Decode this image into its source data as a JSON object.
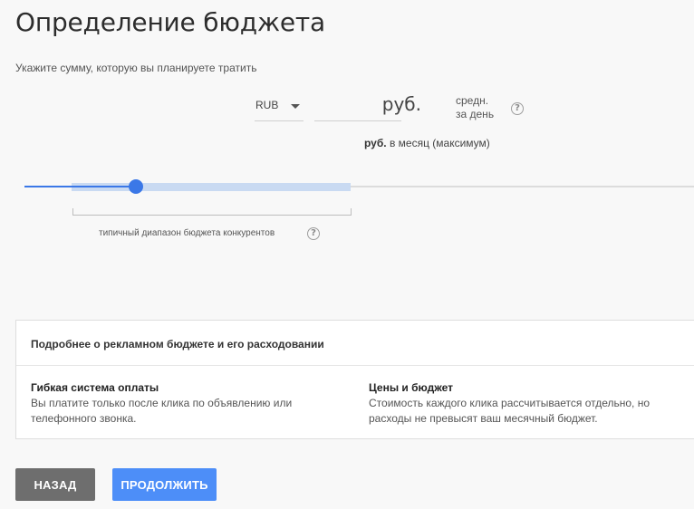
{
  "header": {
    "title": "Определение бюджета",
    "subtitle": "Укажите сумму, которую вы планируете тратить"
  },
  "budget": {
    "currency": "RUB",
    "amount_value": "",
    "amount_placeholder": "",
    "unit": "руб.",
    "per_day_line1": "средн.",
    "per_day_line2": "за день",
    "monthly_unit": "руб.",
    "monthly_text": "в месяц (максимум)"
  },
  "slider": {
    "value_fraction": 0.16,
    "competitor_range_label": "типичный диапазон бюджета конкурентов",
    "accent": "#3b78e7",
    "range_color": "#c9daf2"
  },
  "info_card": {
    "title": "Подробнее о рекламном бюджете и его расходовании",
    "columns": [
      {
        "heading": "Гибкая система оплаты",
        "text": "Вы платите только после клика по объявлению или телефонного звонка."
      },
      {
        "heading": "Цены и бюджет",
        "text": "Стоимость каждого клика рассчитывается отдельно, но расходы не превысят ваш месячный бюджет."
      }
    ]
  },
  "help_icon_glyph": "?",
  "actions": {
    "back_label": "НАЗАД",
    "next_label": "ПРОДОЛЖИТЬ",
    "back_color": "#6e6e6e",
    "next_color": "#4d8ef8"
  }
}
